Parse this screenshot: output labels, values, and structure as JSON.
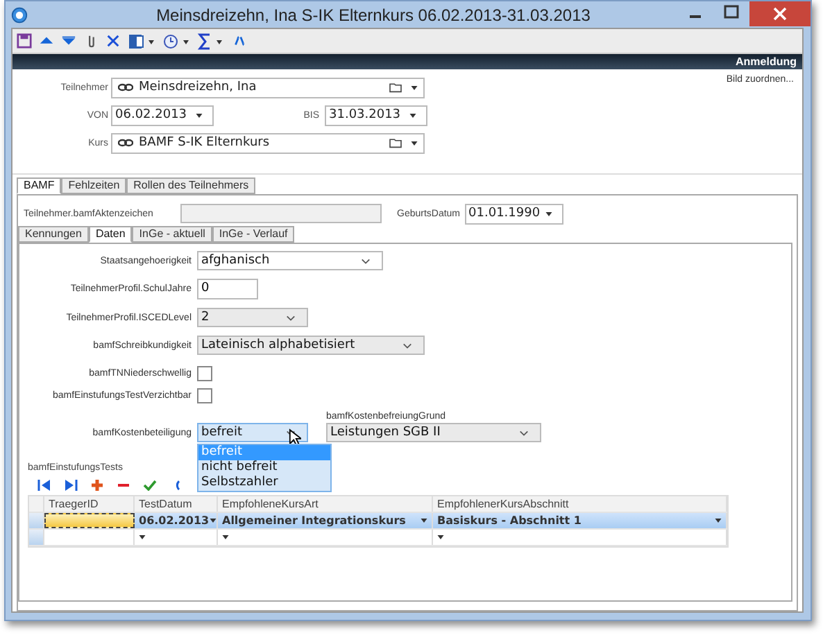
{
  "window": {
    "title": "Meinsdreizehn, Ina  S-IK Elternkurs  06.02.2013-31.03.2013"
  },
  "banner": {
    "title": "Anmeldung"
  },
  "bild_link": "Bild zuordnen...",
  "header": {
    "teilnehmer": {
      "label": "Teilnehmer",
      "value": "Meinsdreizehn, Ina"
    },
    "von": {
      "label": "VON",
      "value": "06.02.2013"
    },
    "bis": {
      "label": "BIS",
      "value": "31.03.2013"
    },
    "kurs": {
      "label": "Kurs",
      "value": "BAMF S-IK Elternkurs"
    }
  },
  "outer_tabs": [
    {
      "label": "BAMF",
      "selected": true
    },
    {
      "label": "Fehlzeiten",
      "selected": false
    },
    {
      "label": "Rollen des Teilnehmers",
      "selected": false
    }
  ],
  "aktenzeichen": {
    "label": "Teilnehmer.bamfAktenzeichen"
  },
  "geburtsdatum": {
    "label": "GeburtsDatum",
    "value": "01.01.1990"
  },
  "inner_tabs": [
    {
      "label": "Kennungen",
      "selected": false
    },
    {
      "label": "Daten",
      "selected": true
    },
    {
      "label": "InGe - aktuell",
      "selected": false
    },
    {
      "label": "InGe - Verlauf",
      "selected": false
    }
  ],
  "form_rows": [
    {
      "kind": "select",
      "label": "Staatsangehoerigkeit",
      "value": "afghanisch"
    },
    {
      "kind": "text",
      "label": "TeilnehmerProfil.SchulJahre",
      "value": "0"
    },
    {
      "kind": "combo",
      "label": "TeilnehmerProfil.ISCEDLevel",
      "value": "2"
    },
    {
      "kind": "combo",
      "label": "bamfSchreibkundigkeit",
      "value": "Lateinisch alphabetisiert"
    },
    {
      "kind": "checkbox",
      "label": "bamfTNNiederschwellig",
      "checked": false
    },
    {
      "kind": "checkbox",
      "label": "bamfEinstufungsTestVerzichtbar",
      "checked": false
    }
  ],
  "kostenbeteiligung": {
    "label": "bamfKostenbeteiligung",
    "value": "befreit",
    "options": [
      {
        "label": "befreit",
        "selected": true
      },
      {
        "label": "nicht befreit",
        "selected": false
      },
      {
        "label": "Selbstzahler",
        "selected": false
      }
    ]
  },
  "kostenbefreiung_grund": {
    "label": "bamfKostenbefreiungGrund",
    "value": "Leistungen SGB II"
  },
  "einstufungs_tests": {
    "title": "bamfEinstufungsTests",
    "columns": [
      "TraegerID",
      "TestDatum",
      "EmpfohleneKursArt",
      "EmpfohlenerKursAbschnitt"
    ],
    "rows": [
      {
        "test_datum": "06.02.2013",
        "kurs_art": "Allgemeiner Integrationskurs",
        "kurs_abschnitt": "Basiskurs - Abschnitt 1",
        "selected": true
      }
    ]
  }
}
